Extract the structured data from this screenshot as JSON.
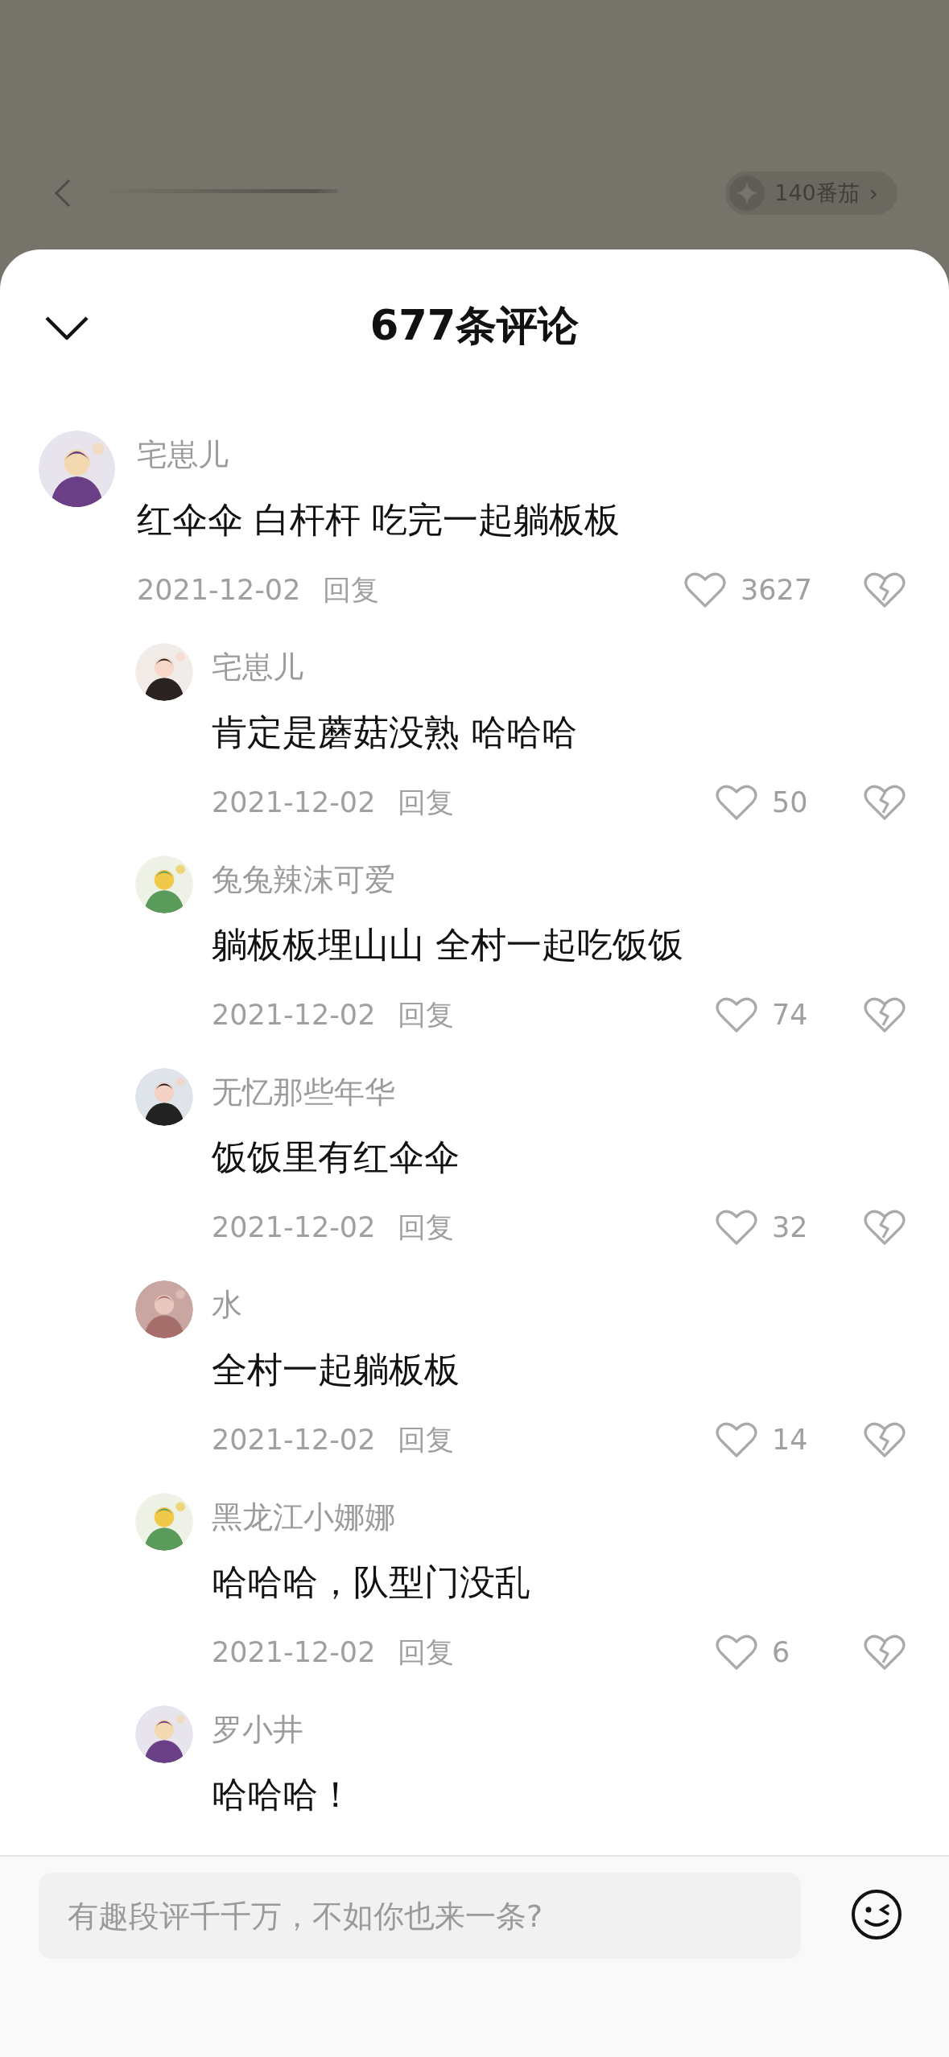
{
  "top_bar": {
    "balance": "140番茄",
    "balance_arrow": "›"
  },
  "sheet": {
    "title": "677条评论"
  },
  "comments": [
    {
      "user": "宅崽儿",
      "text": "红伞伞 白杆杆 吃完一起躺板板",
      "date": "2021-12-02",
      "reply_label": "回复",
      "likes": "3627",
      "children": [
        {
          "user": "宅崽儿",
          "text": "肯定是蘑菇没熟 哈哈哈",
          "date": "2021-12-02",
          "reply_label": "回复",
          "likes": "50"
        },
        {
          "user": "兔兔辣沫可爱",
          "text": "躺板板埋山山 全村一起吃饭饭",
          "date": "2021-12-02",
          "reply_label": "回复",
          "likes": "74"
        },
        {
          "user": "无忆那些年华",
          "text": "饭饭里有红伞伞",
          "date": "2021-12-02",
          "reply_label": "回复",
          "likes": "32"
        },
        {
          "user": "水",
          "text": "全村一起躺板板",
          "date": "2021-12-02",
          "reply_label": "回复",
          "likes": "14"
        },
        {
          "user": "黑龙江小娜娜",
          "text": "哈哈哈，队型门没乱",
          "date": "2021-12-02",
          "reply_label": "回复",
          "likes": "6"
        },
        {
          "user": "罗小井",
          "text": "哈哈哈！"
        }
      ]
    }
  ],
  "input": {
    "placeholder": "有趣段评千千万，不如你也来一条?"
  }
}
